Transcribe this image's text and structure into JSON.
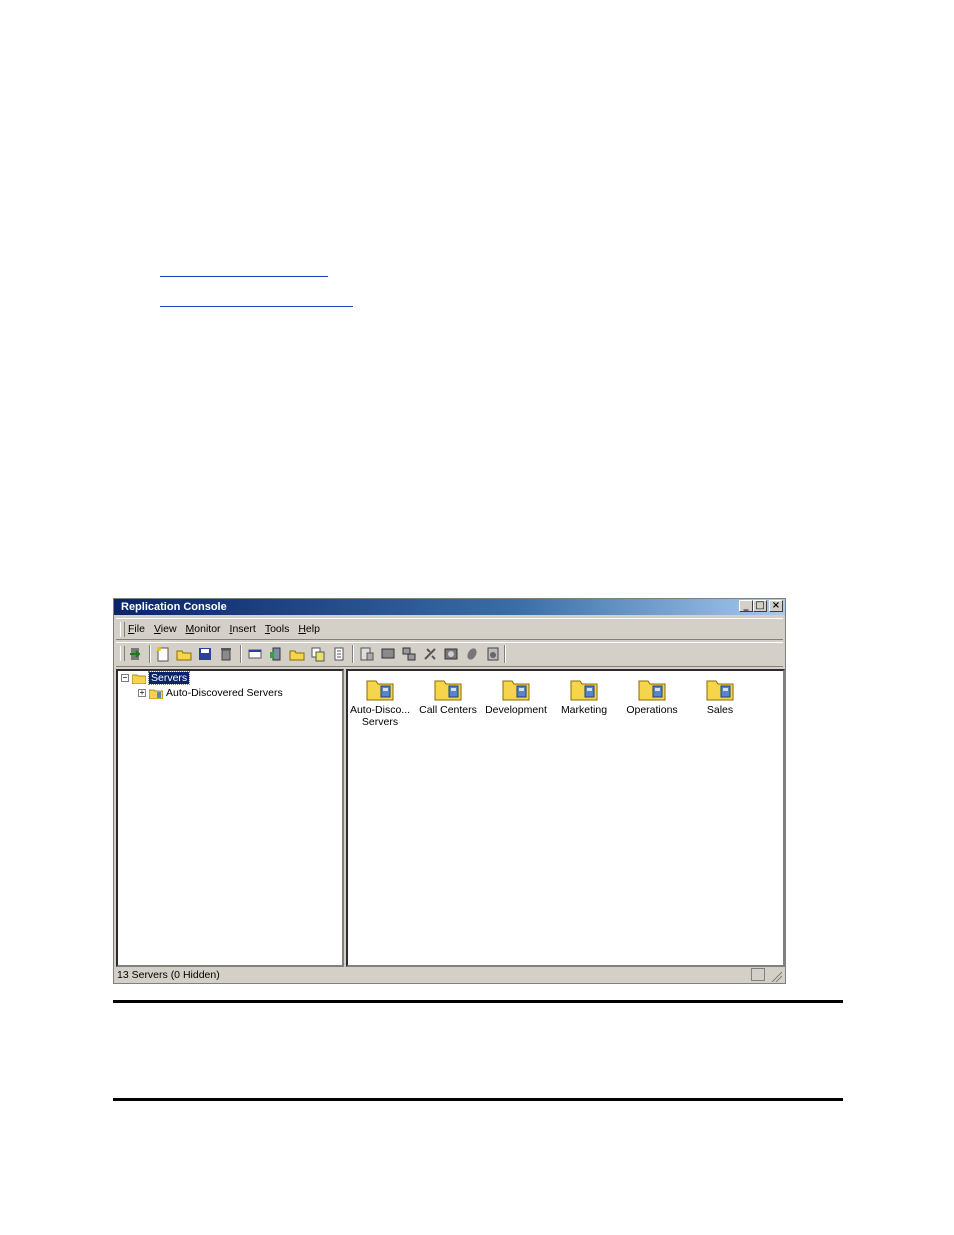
{
  "window": {
    "title": "Replication Console",
    "controls": {
      "minimize": "_",
      "maximize": "□",
      "close": "×"
    }
  },
  "menu": [
    "File",
    "View",
    "Monitor",
    "Insert",
    "Tools",
    "Help"
  ],
  "toolbar": {
    "icons": [
      "exit-icon",
      "new-icon",
      "open-icon",
      "save-icon",
      "delete-icon",
      "properties-icon",
      "server-icon",
      "folder-icon",
      "copy-icon",
      "details-icon",
      "report-icon",
      "monitor-icon",
      "network-icon",
      "connect-icon",
      "view-icon",
      "plug-icon",
      "settings-icon"
    ]
  },
  "tree": {
    "root": {
      "label": "Servers",
      "expander": "−"
    },
    "children": [
      {
        "label": "Auto-Discovered Servers",
        "expander": "+"
      }
    ]
  },
  "main": {
    "items": [
      {
        "label": "Auto-Disco... Servers"
      },
      {
        "label": "Call Centers"
      },
      {
        "label": "Development"
      },
      {
        "label": "Marketing"
      },
      {
        "label": "Operations"
      },
      {
        "label": "Sales"
      }
    ]
  },
  "status": {
    "text": "13 Servers (0 Hidden)"
  },
  "colors": {
    "titlebar": "#0a246a",
    "folder": "#f7d54a",
    "selection": "#0a246a"
  }
}
